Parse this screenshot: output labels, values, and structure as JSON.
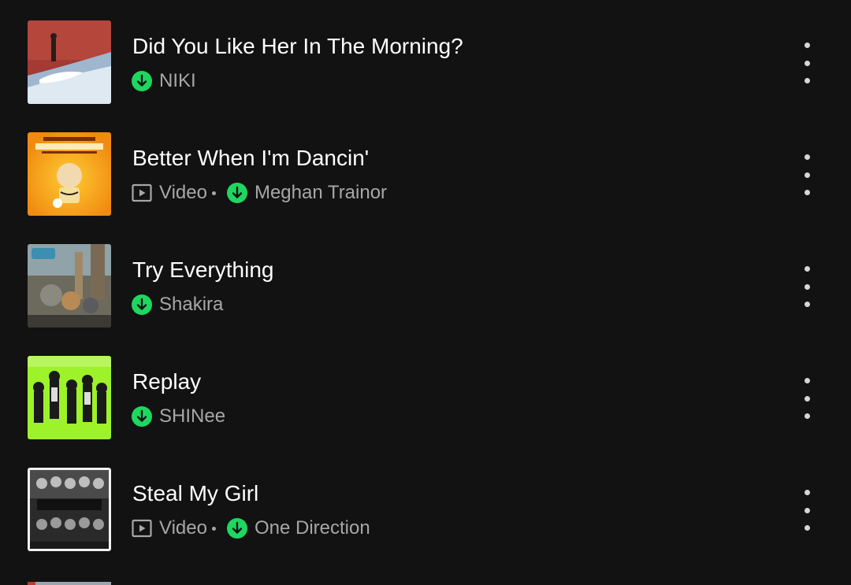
{
  "colors": {
    "background": "#121212",
    "title": "#ffffff",
    "subtitle": "#a7a7a7",
    "download_accent": "#1ed760"
  },
  "icons": {
    "download": "download-circle-icon",
    "video": "video-play-icon",
    "more": "more-options-icon"
  },
  "tracks": [
    {
      "title": "Did You Like Her In The Morning?",
      "artist": "NIKI",
      "video_label": ""
    },
    {
      "title": "Better When I'm Dancin'",
      "artist": "Meghan Trainor",
      "video_label": "Video"
    },
    {
      "title": "Try Everything",
      "artist": "Shakira",
      "video_label": ""
    },
    {
      "title": "Replay",
      "artist": "SHINee",
      "video_label": ""
    },
    {
      "title": "Steal My Girl",
      "artist": "One Direction",
      "video_label": "Video"
    }
  ]
}
